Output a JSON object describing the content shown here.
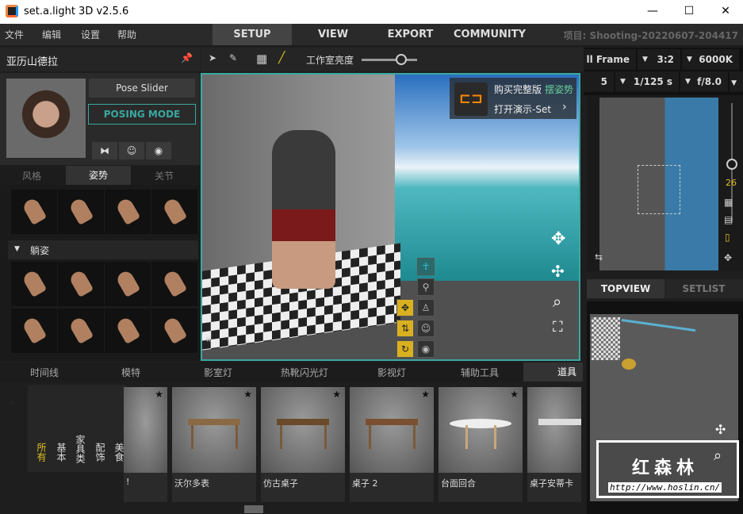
{
  "window": {
    "title": "set.a.light 3D v2.5.6",
    "minimize": "—",
    "maximize": "☐",
    "close": "✕"
  },
  "menu": [
    "文件",
    "编辑",
    "设置",
    "帮助"
  ],
  "mode_tabs": [
    {
      "label": "SETUP",
      "active": true
    },
    {
      "label": "VIEW"
    },
    {
      "label": "EXPORT"
    },
    {
      "label": "COMMUNITY"
    }
  ],
  "project": "项目: Shooting-20220607-204417",
  "model_panel": {
    "name": "亚历山德拉",
    "pose_slider": "Pose Slider",
    "posing_mode": "POSING MODE",
    "tabs": [
      "风格",
      "姿势",
      "关节"
    ],
    "active_tab": "姿势",
    "section": "躺姿"
  },
  "toolbar": {
    "brightness_label": "工作室亮度",
    "brightness": 0.65
  },
  "camera": {
    "sensor": "ll Frame",
    "ratio": "3:2",
    "white_balance": "6000K",
    "focal": "5 mm",
    "shutter": "1/125 s",
    "aperture": "f/8.0",
    "zoom_value": "26"
  },
  "overlay": {
    "buy": "购买完整版",
    "hint": "摆姿势",
    "open_demo": "打开演示-Set",
    "chevron": "›"
  },
  "right_tabs": [
    "TOPVIEW",
    "SETLIST"
  ],
  "bottom_tabs": [
    "时间线",
    "模特",
    "影室灯",
    "热靴闪光灯",
    "影视灯",
    "辅助工具",
    "道具"
  ],
  "active_bottom_tab": "道具",
  "categories": [
    "所有",
    "基本",
    "家具类",
    "配饰",
    "美食"
  ],
  "props": [
    {
      "label": "!"
    },
    {
      "label": "沃尔多表"
    },
    {
      "label": "仿古桌子"
    },
    {
      "label": "桌子 2"
    },
    {
      "label": "台面回合"
    },
    {
      "label": "桌子安蒂卡"
    }
  ],
  "watermark": {
    "text": "红森林",
    "url": "http://www.hoslin.cn/"
  },
  "colors": {
    "accent": "#3aa8a0",
    "highlight": "#e0c020"
  }
}
